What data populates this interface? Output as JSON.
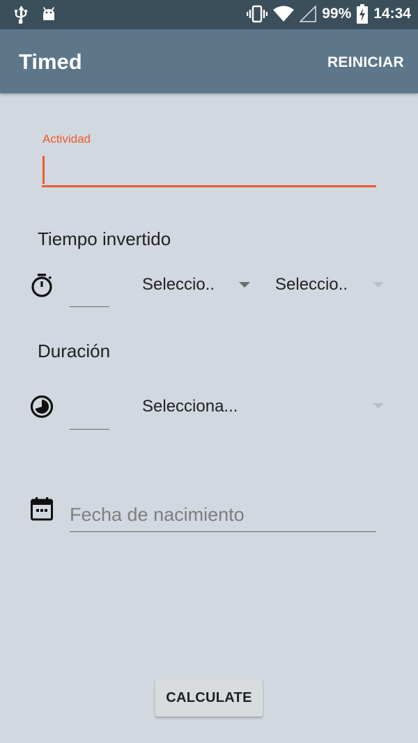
{
  "status_bar": {
    "battery_percent": "99%",
    "time": "14:34",
    "icons": [
      "usb-icon",
      "android-debug-icon",
      "vibrate-icon",
      "wifi-icon",
      "no-signal-icon",
      "battery-charging-icon"
    ]
  },
  "app_bar": {
    "title": "Timed",
    "action_label": "REINICIAR",
    "color": "#5d7689"
  },
  "activity": {
    "label": "Actividad",
    "value": "",
    "accent_color": "#ee5a2c"
  },
  "time_spent": {
    "title": "Tiempo invertido",
    "icon": "stopwatch-icon",
    "amount_value": "",
    "unit_spinner": "Seleccio..",
    "frequency_spinner": "Seleccio.."
  },
  "duration": {
    "title": "Duración",
    "icon": "timelapse-icon",
    "amount_value": "",
    "unit_spinner": "Selecciona..."
  },
  "birth_date": {
    "icon": "calendar-icon",
    "placeholder": "Fecha de nacimiento",
    "value": ""
  },
  "calculate_button": {
    "label": "CALCULATE"
  }
}
